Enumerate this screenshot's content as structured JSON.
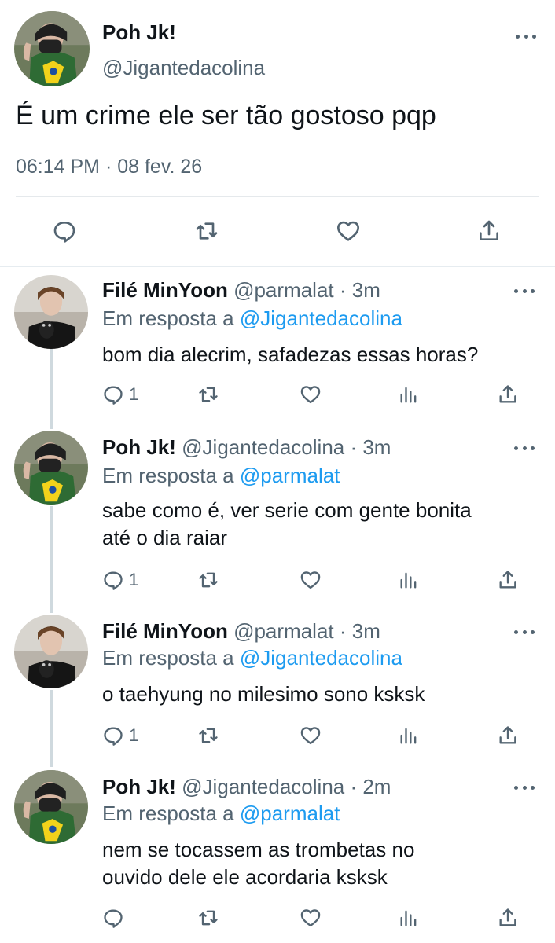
{
  "main_tweet": {
    "name": "Poh Jk!",
    "handle": "@Jigantedacolina",
    "text": "É um crime ele ser tão gostoso pqp",
    "timestamp": "06:14 PM · 08 fev. 26",
    "actions": [
      "reply-icon",
      "retweet-icon",
      "like-icon",
      "share-icon"
    ]
  },
  "replies": [
    {
      "name": "Filé MinYoon",
      "meta": "@parmalat · 3m",
      "replying_prefix": "Em resposta a ",
      "replying_to": "@Jigantedacolina",
      "text": "bom dia alecrim, safadezas essas horas?",
      "reply_count": "1"
    },
    {
      "name": "Poh Jk!",
      "meta": "@Jigantedacolina · 3m",
      "replying_prefix": "Em resposta a ",
      "replying_to": "@parmalat",
      "text_lines": [
        "sabe como é, ver serie com gente bonita",
        "até o dia raiar"
      ],
      "reply_count": "1"
    },
    {
      "name": "Filé MinYoon",
      "meta": "@parmalat · 3m",
      "replying_prefix": "Em resposta a ",
      "replying_to": "@Jigantedacolina",
      "text": "o taehyung no milesimo sono ksksk",
      "reply_count": "1"
    },
    {
      "name": "Poh Jk!",
      "meta": "@Jigantedacolina · 2m",
      "replying_prefix": "Em resposta a ",
      "replying_to": "@parmalat",
      "text_lines": [
        "nem se tocassem as trombetas no",
        "ouvido dele ele acordaria ksksk"
      ],
      "reply_count": ""
    }
  ],
  "colors": {
    "text": "#0f1419",
    "secondary": "#536471",
    "mention": "#1d9bf0",
    "divider": "#e6ecf0"
  }
}
